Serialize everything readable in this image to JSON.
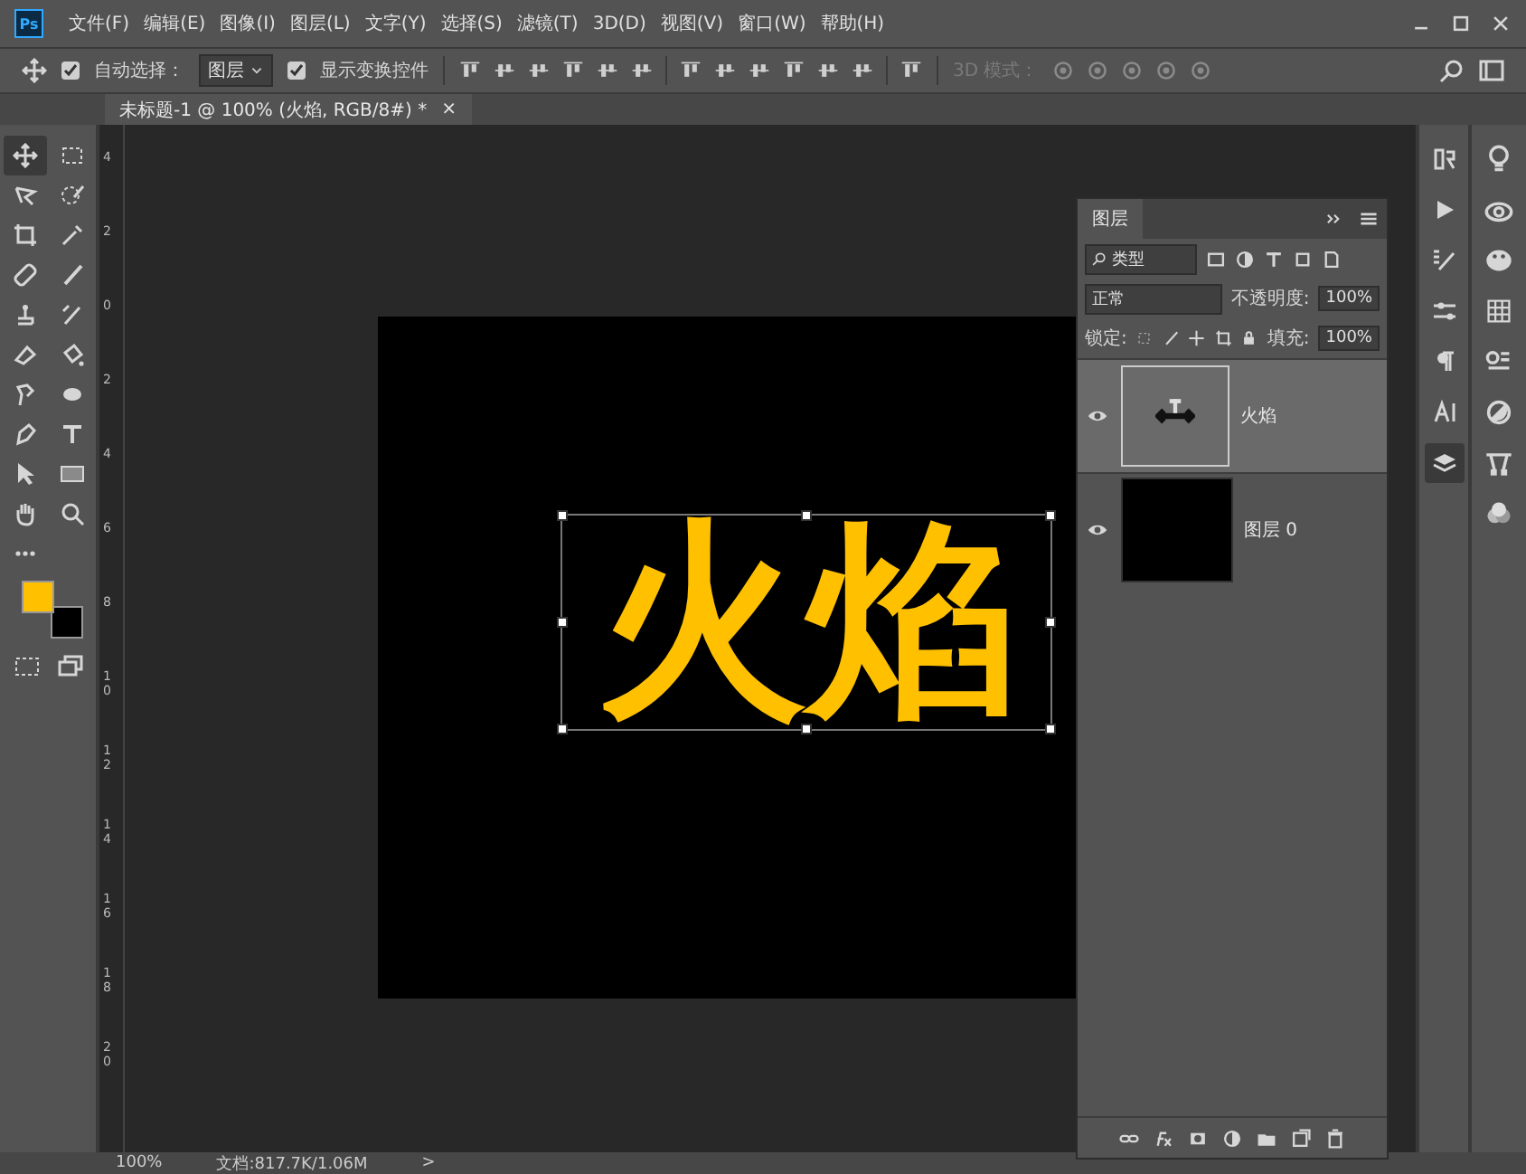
{
  "app": {
    "logo": "Ps"
  },
  "menu": [
    "文件(F)",
    "编辑(E)",
    "图像(I)",
    "图层(L)",
    "文字(Y)",
    "选择(S)",
    "滤镜(T)",
    "3D(D)",
    "视图(V)",
    "窗口(W)",
    "帮助(H)"
  ],
  "options_bar": {
    "auto_select": {
      "label": "自动选择：",
      "checked": true
    },
    "auto_select_target": "图层",
    "show_transform": {
      "label": "显示变换控件",
      "checked": true
    },
    "mode_3d": {
      "label": "3D 模式：",
      "disabled": true
    }
  },
  "document_tab": {
    "title": "未标题-1 @ 100% (火焰, RGB/8#) *",
    "close": "×",
    "selected": true
  },
  "tools": [
    {
      "selected": true
    },
    {
      "selected": false
    },
    {
      "selected": false
    },
    {
      "selected": false
    },
    {
      "selected": false
    },
    {
      "selected": false
    },
    {
      "selected": false
    },
    {
      "selected": false
    },
    {
      "selected": false
    },
    {
      "selected": false
    },
    {
      "selected": false
    },
    {
      "selected": false
    },
    {
      "selected": false
    },
    {
      "selected": false
    },
    {
      "selected": false
    },
    {
      "selected": false
    },
    {
      "selected": false
    },
    {
      "selected": false
    },
    {
      "selected": false
    },
    {
      "selected": false
    },
    {
      "selected": false
    }
  ],
  "swatches": [
    {
      "color": "#ffc000"
    },
    {
      "color": "#000000"
    }
  ],
  "ruler": {
    "labels": [
      "4",
      "2",
      "0",
      "2",
      "4",
      "6",
      "8",
      "10",
      "12",
      "14",
      "16",
      "18",
      "20"
    ]
  },
  "canvas": {
    "text": "火焰",
    "color": "#ffc000",
    "transform_box": true
  },
  "layers_panel": {
    "title": "图层",
    "filter": "类型",
    "blend_mode": "正常",
    "opacity_label": "不透明度:",
    "opacity": "100%",
    "lock_label": "锁定:",
    "fill_label": "填充:",
    "fill": "100%",
    "layers": [
      {
        "name": "火焰",
        "kind": "text",
        "visible": true,
        "selected": true
      },
      {
        "name": "图层 0",
        "kind": "fill",
        "visible": true,
        "selected": false
      }
    ]
  },
  "dock": [
    {
      "selected": false
    },
    {
      "selected": false
    },
    {
      "selected": false
    },
    {
      "selected": false
    },
    {
      "selected": false
    },
    {
      "selected": false
    },
    {
      "selected": true
    }
  ],
  "status_bar": {
    "zoom": "100%",
    "document": "文档:817.7K/1.06M",
    "arrow": ">"
  }
}
